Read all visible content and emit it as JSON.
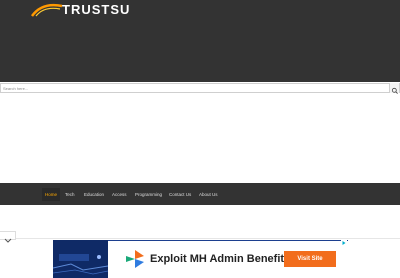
{
  "header": {
    "logo_text": "TRUSTSU"
  },
  "search": {
    "placeholder": "Search here..."
  },
  "nav": {
    "items": [
      {
        "label": "Home",
        "active": true
      },
      {
        "label": "Tech",
        "active": false
      },
      {
        "label": "Education",
        "active": false
      },
      {
        "label": "Access",
        "active": false
      },
      {
        "label": "Programming",
        "active": false
      },
      {
        "label": "Contact Us",
        "active": false
      },
      {
        "label": "About Us",
        "active": false
      }
    ]
  },
  "ad": {
    "headline": "Exploit MH Admin Benefits",
    "cta_label": "Visit Site"
  },
  "colors": {
    "header_bg": "#333333",
    "accent_orange": "#ffaa00",
    "ad_blue": "#1c3f8f",
    "cta_orange": "#f26d1c"
  },
  "icons": {
    "search": "search-icon",
    "toggle": "chevron-down-icon",
    "ad_choices": "adchoices-icon"
  }
}
